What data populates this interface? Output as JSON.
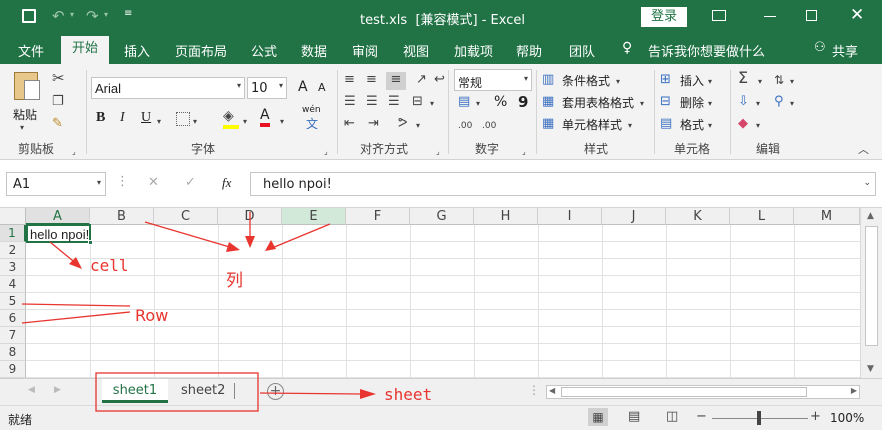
{
  "title_bar": {
    "title": "test.xls  [兼容模式] - Excel",
    "signin": "登录"
  },
  "tabs": [
    "文件",
    "开始",
    "插入",
    "页面布局",
    "公式",
    "数据",
    "审阅",
    "视图",
    "加载项",
    "帮助",
    "团队"
  ],
  "tell_me": "告诉我你想要做什么",
  "share": "共享",
  "ribbon": {
    "clipboard": {
      "paste": "粘贴",
      "label": "剪贴板"
    },
    "font": {
      "name": "Arial",
      "size": "10",
      "label": "字体",
      "bold": "B",
      "italic": "I",
      "underline": "U",
      "grow": "A",
      "shrink": "A",
      "phonetic": "wén"
    },
    "alignment": {
      "label": "对齐方式"
    },
    "number": {
      "format": "常规",
      "label": "数字",
      "percent": "%",
      "comma": "9"
    },
    "styles": {
      "conditional": "条件格式",
      "table": "套用表格格式",
      "cell": "单元格样式",
      "label": "样式"
    },
    "cells": {
      "insert": "插入",
      "delete": "删除",
      "format": "格式",
      "label": "单元格"
    },
    "editing": {
      "label": "编辑"
    }
  },
  "formula_bar": {
    "name_box": "A1",
    "fx": "fx",
    "content": "hello npoi!"
  },
  "columns": [
    "A",
    "B",
    "C",
    "D",
    "E",
    "F",
    "G",
    "H",
    "I",
    "J",
    "K",
    "L",
    "M"
  ],
  "rows": [
    "1",
    "2",
    "3",
    "4",
    "5",
    "6",
    "7",
    "8",
    "9"
  ],
  "cell_a1": "hello npoi!",
  "sheets": [
    "sheet1",
    "sheet2"
  ],
  "status": {
    "ready": "就绪",
    "zoom": "100%"
  },
  "annotations": {
    "cell": "cell",
    "column": "列",
    "row": "Row",
    "sheet": "sheet"
  },
  "colors": {
    "excel_green": "#217346",
    "annotation_red": "#e8352f",
    "selected_col": "#d2e8d9"
  }
}
